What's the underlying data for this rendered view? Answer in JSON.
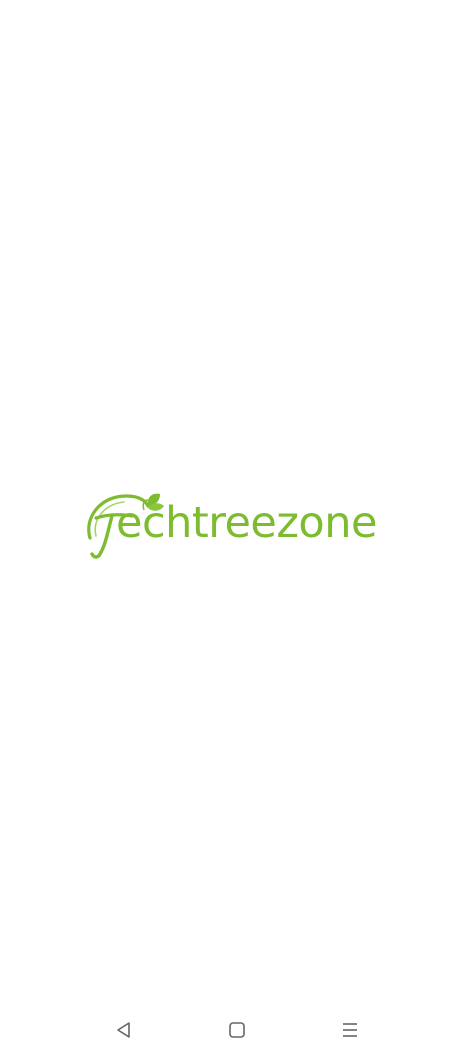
{
  "app": {
    "brand_text": "echtreezone",
    "brand_full": "Techtreezone",
    "brand_color": "#7dbb2f"
  },
  "navigation": {
    "back_icon": "triangle-back-icon",
    "home_icon": "square-home-icon",
    "menu_icon": "hamburger-menu-icon"
  }
}
